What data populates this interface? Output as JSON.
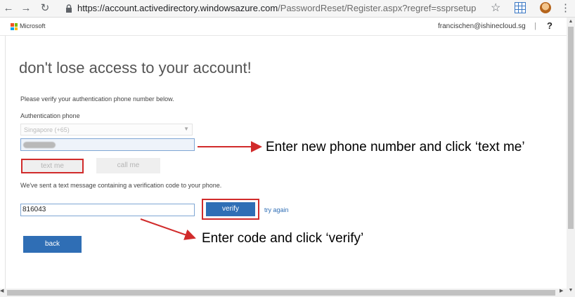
{
  "browser": {
    "url_domain": "https://account.activedirectory.windowsazure.com",
    "url_path": "/PasswordReset/Register.aspx?regref=ssprsetup",
    "icons": [
      "back-arrow-icon",
      "forward-arrow-icon",
      "reload-icon",
      "lock-icon",
      "star-icon",
      "extension-icon",
      "avatar",
      "kebab-menu-icon"
    ]
  },
  "header": {
    "brand": "Microsoft",
    "user_email": "francischen@ishinecloud.sg",
    "separator": "|",
    "help": "?"
  },
  "form": {
    "title": "don't lose access to your account!",
    "instruction": "Please verify your authentication phone number below.",
    "phone_label": "Authentication phone",
    "country_value": "Singapore (+65)",
    "text_me_label": "text me",
    "call_me_label": "call me",
    "sent_message": "We've sent a text message containing a verification code to your phone.",
    "code_value": "816043",
    "verify_label": "verify",
    "try_again_label": "try again",
    "back_label": "back"
  },
  "annotations": {
    "phone_note": "Enter new phone number and click ‘text me’",
    "code_note": "Enter code and click ‘verify’",
    "color": "#d12b2b"
  },
  "colors": {
    "primary_button": "#2f6eb5",
    "highlight_border": "#d12b2b",
    "ms_logo": [
      "#f25022",
      "#7fba00",
      "#00a4ef",
      "#ffb900"
    ]
  }
}
